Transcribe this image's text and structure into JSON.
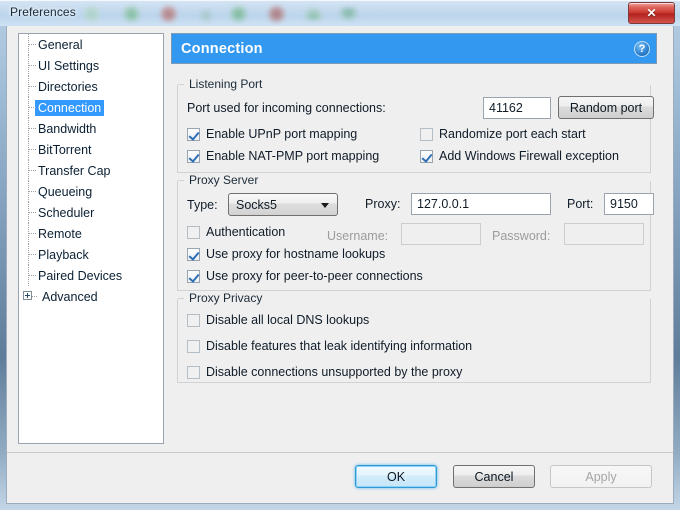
{
  "window": {
    "title": "Preferences",
    "close_label": "✕",
    "accent_blue": "#3399f0",
    "selection_blue": "#3399ff",
    "close_red": "#c8322a"
  },
  "sidebar": {
    "items": [
      {
        "label": "General",
        "selected": false,
        "expandable": false
      },
      {
        "label": "UI Settings",
        "selected": false,
        "expandable": false
      },
      {
        "label": "Directories",
        "selected": false,
        "expandable": false
      },
      {
        "label": "Connection",
        "selected": true,
        "expandable": false
      },
      {
        "label": "Bandwidth",
        "selected": false,
        "expandable": false
      },
      {
        "label": "BitTorrent",
        "selected": false,
        "expandable": false
      },
      {
        "label": "Transfer Cap",
        "selected": false,
        "expandable": false
      },
      {
        "label": "Queueing",
        "selected": false,
        "expandable": false
      },
      {
        "label": "Scheduler",
        "selected": false,
        "expandable": false
      },
      {
        "label": "Remote",
        "selected": false,
        "expandable": false
      },
      {
        "label": "Playback",
        "selected": false,
        "expandable": false
      },
      {
        "label": "Paired Devices",
        "selected": false,
        "expandable": false
      },
      {
        "label": "Advanced",
        "selected": false,
        "expandable": true
      }
    ]
  },
  "panel": {
    "title": "Connection",
    "help_label": "?"
  },
  "listening_port": {
    "group_title": "Listening Port",
    "port_label": "Port used for incoming connections:",
    "port_value": "41162",
    "random_port_button": "Random port",
    "upnp_label": "Enable UPnP port mapping",
    "upnp_checked": true,
    "natpmp_label": "Enable NAT-PMP port mapping",
    "natpmp_checked": true,
    "randomize_label": "Randomize port each start",
    "randomize_checked": false,
    "firewall_label": "Add Windows Firewall exception",
    "firewall_checked": true
  },
  "proxy_server": {
    "group_title": "Proxy Server",
    "type_label": "Type:",
    "type_value": "Socks5",
    "proxy_label": "Proxy:",
    "proxy_value": "127.0.0.1",
    "port_label": "Port:",
    "port_value": "9150",
    "authentication_label": "Authentication",
    "authentication_checked": false,
    "username_label": "Username:",
    "username_value": "",
    "password_label": "Password:",
    "password_value": "",
    "hostname_label": "Use proxy for hostname lookups",
    "hostname_checked": true,
    "p2p_label": "Use proxy for peer-to-peer connections",
    "p2p_checked": true
  },
  "proxy_privacy": {
    "group_title": "Proxy Privacy",
    "dns_label": "Disable all local DNS lookups",
    "dns_checked": false,
    "leak_label": "Disable features that leak identifying information",
    "leak_checked": false,
    "unsupported_label": "Disable connections unsupported by the proxy",
    "unsupported_checked": false
  },
  "footer": {
    "ok_label": "OK",
    "cancel_label": "Cancel",
    "apply_label": "Apply"
  }
}
